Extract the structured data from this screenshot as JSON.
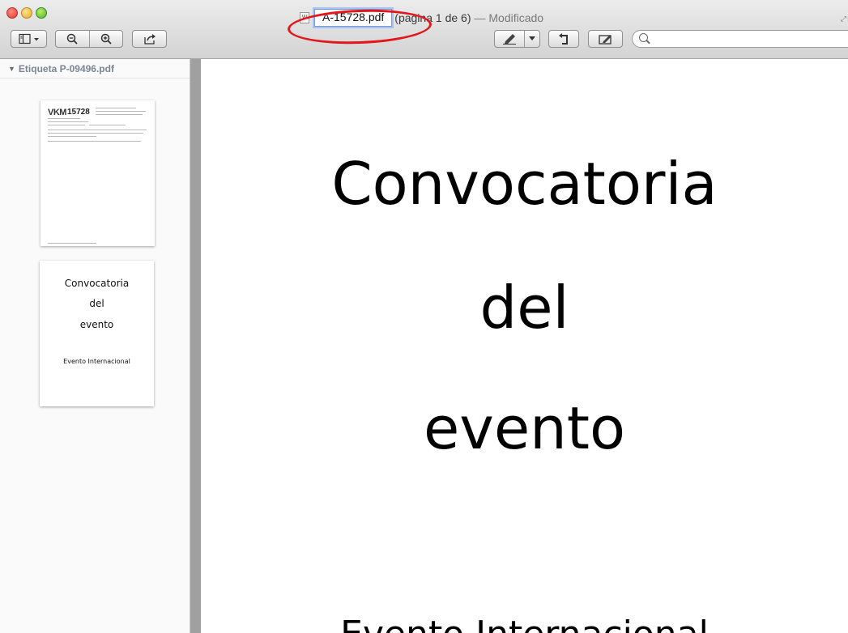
{
  "window": {
    "filename": "A-15728.pdf",
    "page_info": "(pagina 1 de 6)",
    "status": "— Modificado",
    "doc_icon": "W"
  },
  "toolbar": {
    "sidebar_toggle_icon": "sidebar-icon",
    "zoom_out_icon": "zoom-out-icon",
    "zoom_in_icon": "zoom-in-icon",
    "share_icon": "share-icon",
    "markup_icon": "pen-icon",
    "rotate_icon": "rotate-icon",
    "annotate_icon": "annotate-icon",
    "search_placeholder": ""
  },
  "sidebar": {
    "header": "Etiqueta P-09496.pdf",
    "thumb1": {
      "logo": "VKM",
      "number": "15728"
    },
    "thumb2": {
      "line1": "Convocatoria",
      "line2": "del",
      "line3": "evento",
      "sub": "Evento Internacional"
    }
  },
  "page": {
    "line1": "Convocatoria",
    "line2": "del",
    "line3": "evento",
    "line4": "Evento Internacional"
  },
  "annotation": {
    "color": "#e3161b"
  }
}
